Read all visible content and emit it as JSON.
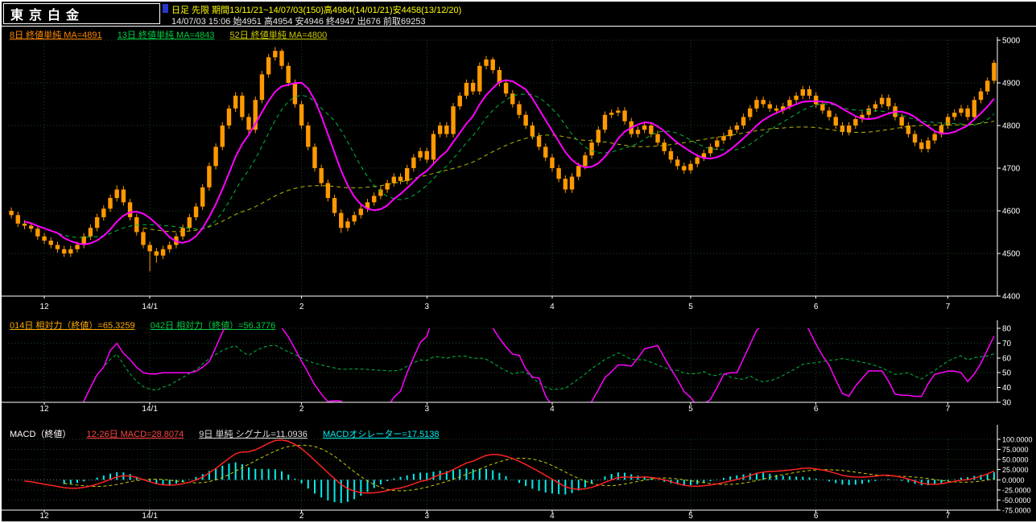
{
  "window": {
    "title": "東京白金"
  },
  "header": {
    "info_line1": "日足 先限  期間13/11/21~14/07/03(150)高4984(14/01/21)安4458(13/12/20)",
    "info_line2": "14/07/03 15:06 始4951 高4954 安4946 終4947 出676 前取69253"
  },
  "colors": {
    "background": "#000000",
    "candle": "#ff9900",
    "ma8": "#ff00ff",
    "ma13": "#00bb44",
    "ma52": "#bbbb00",
    "grid": "#1d4a1d",
    "axis_text": "#ffffff",
    "panel_border": "#ffffff",
    "rsi_line": "#ff00ff",
    "rsi2_line": "#00bb44",
    "macd_line": "#ff2222",
    "signal_line": "#cccc00",
    "histogram": "#00eeee",
    "header_text": "#ffff00",
    "header_marker": "#2838c8"
  },
  "main_chart": {
    "legend": [
      {
        "label": "8日 終値単純 MA=4891",
        "color": "#ff8800"
      },
      {
        "label": "13日 終値単純 MA=4843",
        "color": "#00cc44"
      },
      {
        "label": "52日 終値単純 MA=4800",
        "color": "#cccc00"
      }
    ],
    "y_ticks": [
      "5000",
      "4900",
      "4800",
      "4700",
      "4600",
      "4500",
      "4400"
    ]
  },
  "rsi_panel": {
    "legend": [
      {
        "label": "014日 相対力（終値）=65.3259",
        "color": "#ffaa00"
      },
      {
        "label": "042日 相対力（終値）=56.3776",
        "color": "#00cc44"
      }
    ],
    "y_ticks": [
      "80",
      "70",
      "60",
      "50",
      "40",
      "30"
    ]
  },
  "macd_panel": {
    "title": "MACD（終値）",
    "title_color": "#ffffff",
    "legend": [
      {
        "label": "12-26日 MACD=28.8074",
        "color": "#ff4444"
      },
      {
        "label": "9日 単純 シグナル=11.0936",
        "color": "#dddddd"
      },
      {
        "label": "MACDオシレーター=17.5138",
        "color": "#00eeee"
      }
    ],
    "y_ticks": [
      "100.0000",
      "75.0000",
      "50.0000",
      "25.0000",
      "0.0000",
      "-25.0000",
      "-50.0000",
      "-75.0000"
    ]
  },
  "chart_data": [
    {
      "type": "candlestick",
      "title": "東京白金 日足 先限",
      "ylim": [
        4400,
        5000
      ],
      "y_tick_step": 100,
      "x_labels": [
        "12",
        "14/1",
        "2",
        "3",
        "4",
        "5",
        "6",
        "7"
      ],
      "x_label_positions": [
        5,
        21,
        44,
        63,
        82,
        103,
        122,
        142
      ],
      "overlays": [
        {
          "name": "MA8",
          "type": "sma",
          "period": 8,
          "current": 4891,
          "style": "solid"
        },
        {
          "name": "MA13",
          "type": "sma",
          "period": 13,
          "current": 4843,
          "style": "dashed"
        },
        {
          "name": "MA52",
          "type": "sma",
          "period": 52,
          "current": 4800,
          "style": "dashed"
        }
      ],
      "ohlc": [
        [
          4600,
          4608,
          4582,
          4590
        ],
        [
          4590,
          4598,
          4562,
          4570
        ],
        [
          4570,
          4578,
          4557,
          4565
        ],
        [
          4565,
          4573,
          4550,
          4558
        ],
        [
          4558,
          4566,
          4532,
          4540
        ],
        [
          4540,
          4548,
          4522,
          4530
        ],
        [
          4530,
          4538,
          4512,
          4520
        ],
        [
          4520,
          4528,
          4502,
          4510
        ],
        [
          4510,
          4518,
          4492,
          4500
        ],
        [
          4500,
          4518,
          4492,
          4510
        ],
        [
          4510,
          4528,
          4502,
          4520
        ],
        [
          4520,
          4548,
          4512,
          4540
        ],
        [
          4540,
          4568,
          4532,
          4560
        ],
        [
          4560,
          4593,
          4552,
          4585
        ],
        [
          4585,
          4613,
          4577,
          4605
        ],
        [
          4605,
          4638,
          4597,
          4630
        ],
        [
          4630,
          4660,
          4622,
          4650
        ],
        [
          4650,
          4658,
          4612,
          4620
        ],
        [
          4620,
          4628,
          4577,
          4585
        ],
        [
          4585,
          4593,
          4542,
          4550
        ],
        [
          4550,
          4558,
          4512,
          4520
        ],
        [
          4520,
          4528,
          4458,
          4505
        ],
        [
          4505,
          4513,
          4478,
          4495
        ],
        [
          4495,
          4518,
          4487,
          4510
        ],
        [
          4510,
          4528,
          4502,
          4520
        ],
        [
          4520,
          4548,
          4512,
          4540
        ],
        [
          4540,
          4568,
          4532,
          4560
        ],
        [
          4560,
          4593,
          4552,
          4585
        ],
        [
          4585,
          4618,
          4577,
          4610
        ],
        [
          4610,
          4663,
          4602,
          4655
        ],
        [
          4655,
          4713,
          4647,
          4705
        ],
        [
          4705,
          4758,
          4697,
          4750
        ],
        [
          4750,
          4808,
          4742,
          4800
        ],
        [
          4800,
          4848,
          4792,
          4840
        ],
        [
          4840,
          4878,
          4832,
          4870
        ],
        [
          4870,
          4878,
          4812,
          4820
        ],
        [
          4820,
          4828,
          4782,
          4790
        ],
        [
          4790,
          4868,
          4782,
          4860
        ],
        [
          4860,
          4928,
          4852,
          4920
        ],
        [
          4920,
          4968,
          4912,
          4960
        ],
        [
          4960,
          4984,
          4952,
          4975
        ],
        [
          4975,
          4980,
          4932,
          4940
        ],
        [
          4940,
          4948,
          4892,
          4900
        ],
        [
          4900,
          4908,
          4842,
          4850
        ],
        [
          4850,
          4858,
          4792,
          4800
        ],
        [
          4800,
          4808,
          4742,
          4750
        ],
        [
          4750,
          4758,
          4692,
          4700
        ],
        [
          4700,
          4708,
          4657,
          4665
        ],
        [
          4665,
          4673,
          4622,
          4630
        ],
        [
          4630,
          4638,
          4587,
          4595
        ],
        [
          4595,
          4603,
          4548,
          4560
        ],
        [
          4560,
          4583,
          4552,
          4575
        ],
        [
          4575,
          4598,
          4567,
          4590
        ],
        [
          4590,
          4613,
          4582,
          4605
        ],
        [
          4605,
          4628,
          4597,
          4620
        ],
        [
          4620,
          4643,
          4612,
          4635
        ],
        [
          4635,
          4658,
          4627,
          4650
        ],
        [
          4650,
          4673,
          4642,
          4665
        ],
        [
          4665,
          4688,
          4657,
          4680
        ],
        [
          4680,
          4688,
          4662,
          4670
        ],
        [
          4670,
          4708,
          4662,
          4700
        ],
        [
          4700,
          4733,
          4692,
          4725
        ],
        [
          4725,
          4748,
          4717,
          4740
        ],
        [
          4740,
          4748,
          4712,
          4720
        ],
        [
          4720,
          4788,
          4712,
          4780
        ],
        [
          4780,
          4808,
          4772,
          4800
        ],
        [
          4800,
          4808,
          4772,
          4780
        ],
        [
          4780,
          4853,
          4772,
          4845
        ],
        [
          4845,
          4878,
          4837,
          4870
        ],
        [
          4870,
          4908,
          4862,
          4900
        ],
        [
          4900,
          4908,
          4872,
          4880
        ],
        [
          4880,
          4948,
          4872,
          4940
        ],
        [
          4940,
          4963,
          4932,
          4955
        ],
        [
          4955,
          4960,
          4922,
          4930
        ],
        [
          4930,
          4938,
          4892,
          4900
        ],
        [
          4900,
          4908,
          4867,
          4875
        ],
        [
          4875,
          4883,
          4842,
          4850
        ],
        [
          4850,
          4858,
          4817,
          4825
        ],
        [
          4825,
          4833,
          4792,
          4800
        ],
        [
          4800,
          4808,
          4767,
          4775
        ],
        [
          4775,
          4783,
          4742,
          4750
        ],
        [
          4750,
          4758,
          4717,
          4725
        ],
        [
          4725,
          4733,
          4692,
          4700
        ],
        [
          4700,
          4708,
          4667,
          4675
        ],
        [
          4675,
          4683,
          4642,
          4650
        ],
        [
          4650,
          4688,
          4642,
          4680
        ],
        [
          4680,
          4713,
          4672,
          4705
        ],
        [
          4705,
          4738,
          4697,
          4730
        ],
        [
          4730,
          4768,
          4722,
          4760
        ],
        [
          4760,
          4798,
          4752,
          4790
        ],
        [
          4790,
          4833,
          4782,
          4825
        ],
        [
          4825,
          4838,
          4817,
          4830
        ],
        [
          4830,
          4843,
          4822,
          4835
        ],
        [
          4835,
          4843,
          4802,
          4810
        ],
        [
          4810,
          4818,
          4772,
          4780
        ],
        [
          4780,
          4798,
          4772,
          4790
        ],
        [
          4790,
          4808,
          4782,
          4800
        ],
        [
          4800,
          4808,
          4772,
          4780
        ],
        [
          4780,
          4788,
          4752,
          4760
        ],
        [
          4760,
          4768,
          4732,
          4740
        ],
        [
          4740,
          4748,
          4712,
          4720
        ],
        [
          4720,
          4728,
          4697,
          4705
        ],
        [
          4705,
          4713,
          4687,
          4695
        ],
        [
          4695,
          4718,
          4687,
          4710
        ],
        [
          4710,
          4733,
          4702,
          4725
        ],
        [
          4725,
          4743,
          4717,
          4735
        ],
        [
          4735,
          4758,
          4727,
          4750
        ],
        [
          4750,
          4773,
          4742,
          4765
        ],
        [
          4765,
          4783,
          4757,
          4775
        ],
        [
          4775,
          4798,
          4767,
          4790
        ],
        [
          4790,
          4808,
          4782,
          4800
        ],
        [
          4800,
          4828,
          4792,
          4820
        ],
        [
          4820,
          4848,
          4812,
          4840
        ],
        [
          4840,
          4868,
          4832,
          4860
        ],
        [
          4860,
          4868,
          4842,
          4850
        ],
        [
          4850,
          4858,
          4832,
          4840
        ],
        [
          4840,
          4848,
          4827,
          4835
        ],
        [
          4835,
          4853,
          4827,
          4845
        ],
        [
          4845,
          4868,
          4837,
          4860
        ],
        [
          4860,
          4878,
          4852,
          4870
        ],
        [
          4870,
          4893,
          4862,
          4885
        ],
        [
          4885,
          4893,
          4862,
          4870
        ],
        [
          4870,
          4878,
          4842,
          4850
        ],
        [
          4850,
          4858,
          4827,
          4835
        ],
        [
          4835,
          4843,
          4812,
          4820
        ],
        [
          4820,
          4828,
          4792,
          4800
        ],
        [
          4800,
          4808,
          4777,
          4785
        ],
        [
          4785,
          4808,
          4777,
          4800
        ],
        [
          4800,
          4823,
          4792,
          4815
        ],
        [
          4815,
          4833,
          4807,
          4825
        ],
        [
          4825,
          4848,
          4817,
          4840
        ],
        [
          4840,
          4858,
          4832,
          4850
        ],
        [
          4850,
          4873,
          4842,
          4865
        ],
        [
          4865,
          4873,
          4837,
          4845
        ],
        [
          4845,
          4853,
          4812,
          4820
        ],
        [
          4820,
          4828,
          4792,
          4800
        ],
        [
          4800,
          4808,
          4772,
          4780
        ],
        [
          4780,
          4788,
          4752,
          4760
        ],
        [
          4760,
          4768,
          4737,
          4745
        ],
        [
          4745,
          4773,
          4737,
          4765
        ],
        [
          4765,
          4788,
          4757,
          4780
        ],
        [
          4780,
          4808,
          4772,
          4800
        ],
        [
          4800,
          4828,
          4792,
          4820
        ],
        [
          4820,
          4838,
          4812,
          4830
        ],
        [
          4830,
          4848,
          4822,
          4840
        ],
        [
          4840,
          4848,
          4812,
          4820
        ],
        [
          4820,
          4868,
          4812,
          4860
        ],
        [
          4860,
          4888,
          4852,
          4880
        ],
        [
          4880,
          4913,
          4872,
          4905
        ],
        [
          4905,
          4954,
          4898,
          4947
        ]
      ]
    },
    {
      "type": "line",
      "name": "相対力 (RSI)",
      "ylim": [
        30,
        80
      ],
      "y_tick_step": 10,
      "source": "close",
      "series": [
        {
          "name": "014日 相対力（終値）",
          "period": 14,
          "current": 65.3259
        },
        {
          "name": "042日 相対力（終値）",
          "period": 42,
          "current": 56.3776
        }
      ]
    },
    {
      "type": "macd",
      "name": "MACD（終値）",
      "ylim": [
        -75,
        100
      ],
      "y_tick_step": 25,
      "fast_period": 12,
      "slow_period": 26,
      "signal_period": 9,
      "signal_type": "単純",
      "current": {
        "macd": 28.8074,
        "signal": 11.0936,
        "oscillator": 17.5138
      }
    }
  ]
}
